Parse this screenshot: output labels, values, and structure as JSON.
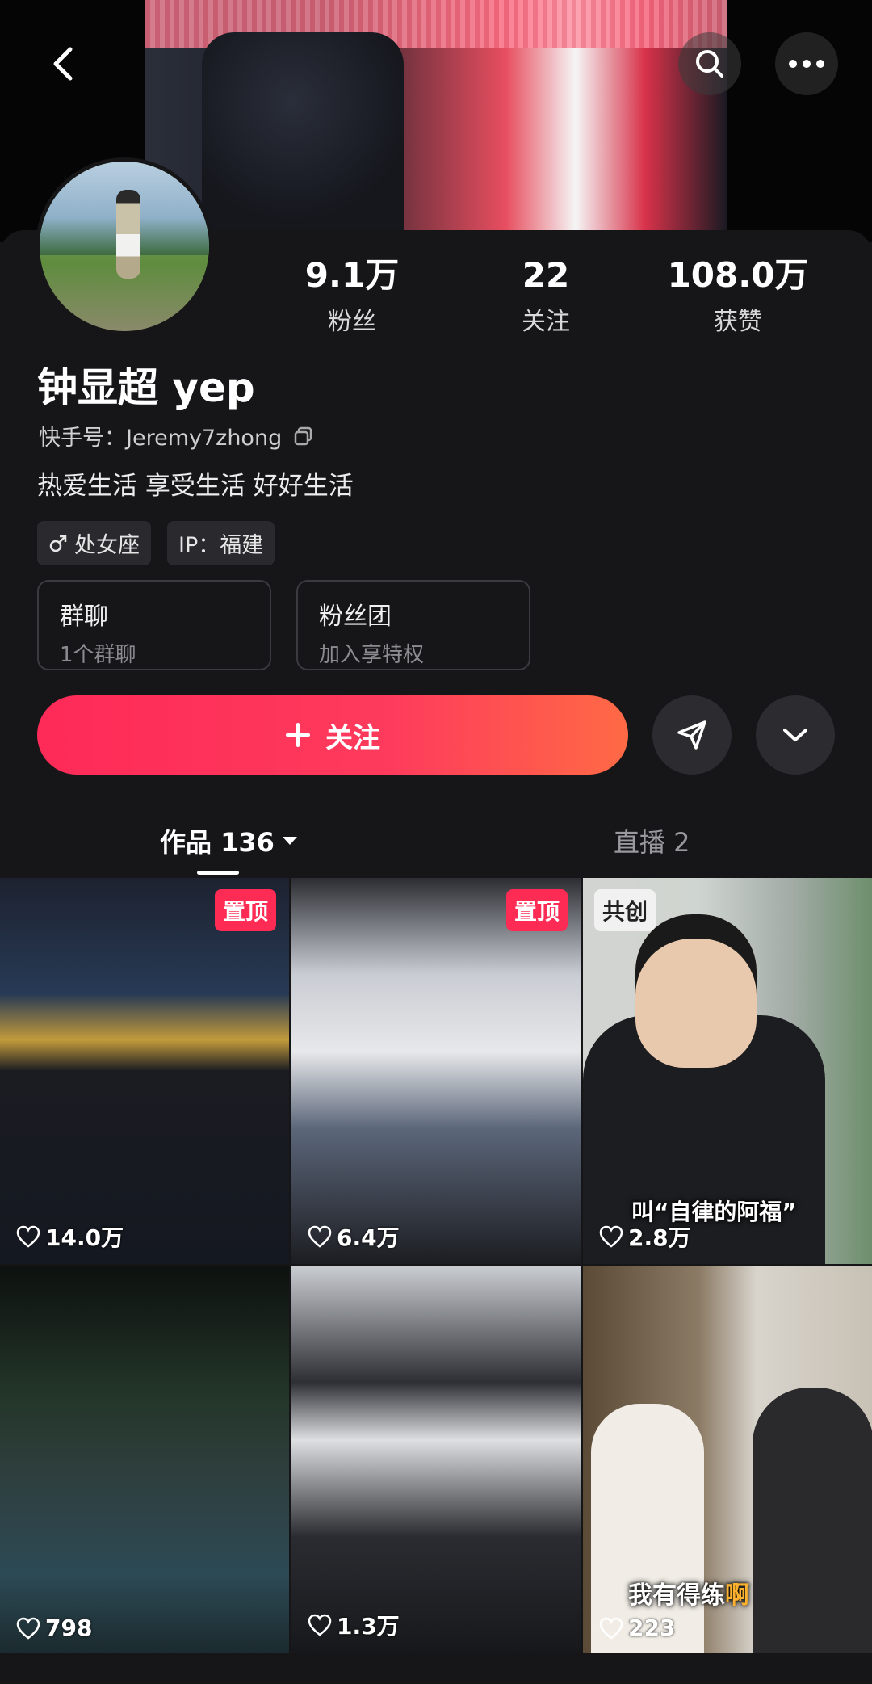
{
  "header": {
    "back_icon": "chevron-left-icon",
    "search_icon": "search-icon",
    "more_icon": "more-dots-icon"
  },
  "profile": {
    "stats": [
      {
        "value": "9.1万",
        "label": "粉丝"
      },
      {
        "value": "22",
        "label": "关注"
      },
      {
        "value": "108.0万",
        "label": "获赞"
      }
    ],
    "name": "钟显超 yep",
    "kuaishou_id": "快手号：Jeremy7zhong",
    "bio": "热爱生活 享受生活 好好生活",
    "tags": [
      {
        "text": "处女座",
        "icon": "male-icon"
      },
      {
        "text": "IP：福建"
      }
    ],
    "cards": [
      {
        "title": "群聊",
        "subtitle": "1个群聊"
      },
      {
        "title": "粉丝团",
        "subtitle": "加入享特权"
      }
    ],
    "follow_label": "关注",
    "accent": "#fe2c55"
  },
  "tabs": {
    "works": "作品 136",
    "live": "直播 2"
  },
  "videos": [
    {
      "badge": "置顶",
      "likes": "14.0万"
    },
    {
      "badge": "置顶",
      "likes": "6.4万"
    },
    {
      "badge": "共创",
      "likes": "2.8万",
      "caption": "叫“自律的阿福”"
    },
    {
      "likes": "798"
    },
    {
      "likes": "1.3万"
    },
    {
      "likes": "223",
      "caption_a": "我有得练",
      "caption_b": "啊"
    }
  ]
}
